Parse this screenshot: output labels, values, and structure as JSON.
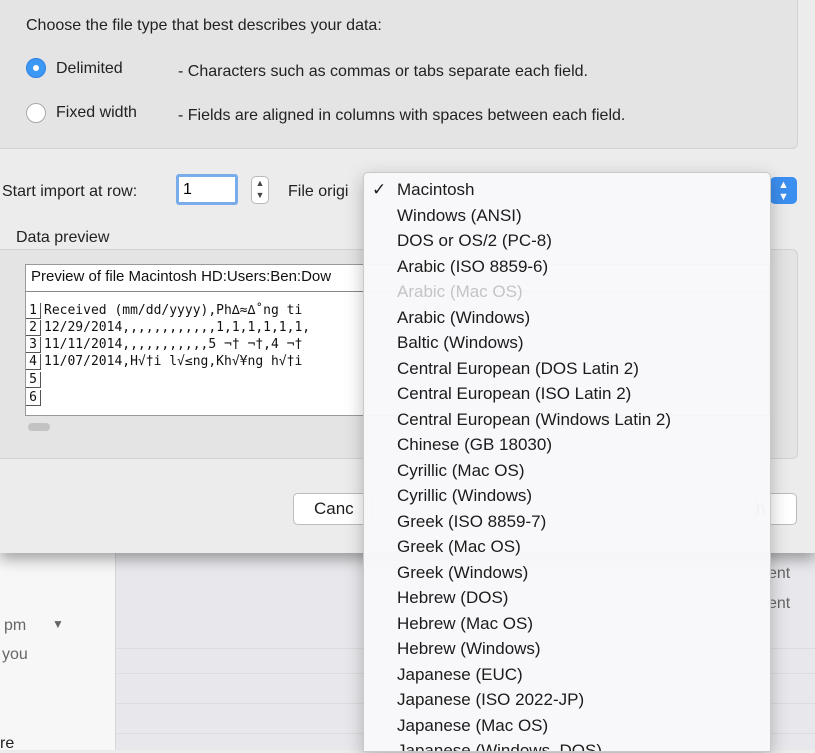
{
  "dialog": {
    "heading": "Choose the file type that best describes your data:",
    "file_types": [
      {
        "label": "Delimited",
        "description": "- Characters such as commas or tabs separate each field.",
        "selected": true
      },
      {
        "label": "Fixed width",
        "description": "- Fields are aligned in columns with spaces between each field.",
        "selected": false
      }
    ],
    "start_row_label": "Start import at row:",
    "start_row_value": "1",
    "file_origin_label": "File origi",
    "data_preview_label": "Data preview",
    "preview_title": "Preview of file Macintosh HD:Users:Ben:Dow",
    "preview_rows": [
      {
        "num": "1",
        "text": "Received (mm/dd/yyyy),Ph∆≈∆˚ng ti"
      },
      {
        "num": "2",
        "text": "12/29/2014,,,,,,,,,,,,1,1,1,1,1,1,"
      },
      {
        "num": "3",
        "text": "11/11/2014,,,,,,,,,,,5 ¬† ¬†,4 ¬†"
      },
      {
        "num": "4",
        "text": "11/07/2014,H√†i l√≤ng,Kh√¥ng h√†i"
      },
      {
        "num": "5",
        "text": ""
      },
      {
        "num": "6",
        "text": ""
      }
    ],
    "cancel_label": "Canc",
    "finish_label": "n"
  },
  "file_origin_menu": {
    "selected": "Macintosh",
    "items": [
      {
        "label": "Macintosh",
        "checked": true,
        "disabled": false
      },
      {
        "label": "Windows (ANSI)",
        "checked": false,
        "disabled": false
      },
      {
        "label": "DOS or OS/2 (PC-8)",
        "checked": false,
        "disabled": false
      },
      {
        "label": "Arabic (ISO 8859-6)",
        "checked": false,
        "disabled": false
      },
      {
        "label": "Arabic (Mac OS)",
        "checked": false,
        "disabled": true
      },
      {
        "label": "Arabic (Windows)",
        "checked": false,
        "disabled": false
      },
      {
        "label": "Baltic (Windows)",
        "checked": false,
        "disabled": false
      },
      {
        "label": "Central European (DOS Latin 2)",
        "checked": false,
        "disabled": false
      },
      {
        "label": "Central European (ISO Latin 2)",
        "checked": false,
        "disabled": false
      },
      {
        "label": "Central European (Windows Latin 2)",
        "checked": false,
        "disabled": false
      },
      {
        "label": "Chinese (GB 18030)",
        "checked": false,
        "disabled": false
      },
      {
        "label": "Cyrillic (Mac OS)",
        "checked": false,
        "disabled": false
      },
      {
        "label": "Cyrillic (Windows)",
        "checked": false,
        "disabled": false
      },
      {
        "label": "Greek (ISO 8859-7)",
        "checked": false,
        "disabled": false
      },
      {
        "label": "Greek (Mac OS)",
        "checked": false,
        "disabled": false
      },
      {
        "label": "Greek (Windows)",
        "checked": false,
        "disabled": false
      },
      {
        "label": "Hebrew (DOS)",
        "checked": false,
        "disabled": false
      },
      {
        "label": "Hebrew (Mac OS)",
        "checked": false,
        "disabled": false
      },
      {
        "label": "Hebrew (Windows)",
        "checked": false,
        "disabled": false
      },
      {
        "label": "Japanese (EUC)",
        "checked": false,
        "disabled": false
      },
      {
        "label": "Japanese (ISO 2022-JP)",
        "checked": false,
        "disabled": false
      },
      {
        "label": "Japanese (Mac OS)",
        "checked": false,
        "disabled": false
      },
      {
        "label": "Japanese (Windows, DOS)",
        "checked": false,
        "disabled": false
      }
    ]
  },
  "background": {
    "sidebar_texts": [
      "pm",
      "you",
      "re"
    ],
    "right_texts": [
      "ent",
      "ent"
    ]
  }
}
